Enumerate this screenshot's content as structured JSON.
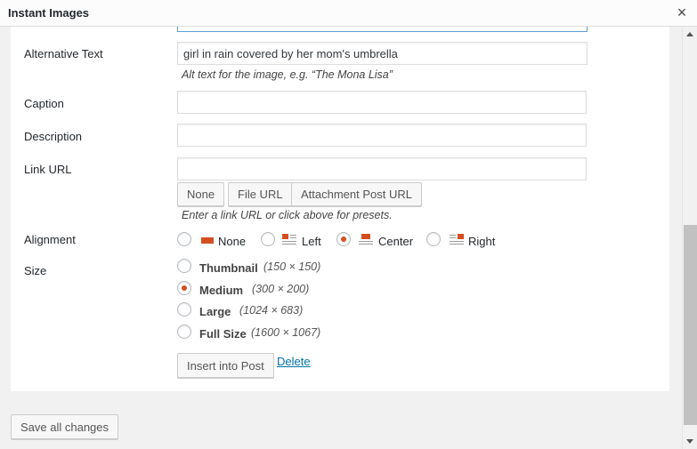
{
  "window": {
    "title": "Instant Images",
    "close_symbol": "×"
  },
  "form": {
    "title_field": {
      "value": ""
    },
    "alt_text": {
      "label": "Alternative Text",
      "value": "girl in rain covered by her mom's umbrella",
      "hint": "Alt text for the image, e.g. “The Mona Lisa”"
    },
    "caption": {
      "label": "Caption",
      "value": ""
    },
    "description": {
      "label": "Description",
      "value": ""
    },
    "link_url": {
      "label": "Link URL",
      "value": "",
      "presets": [
        "None",
        "File URL",
        "Attachment Post URL"
      ],
      "hint": "Enter a link URL or click above for presets."
    },
    "alignment": {
      "label": "Alignment",
      "options": [
        "None",
        "Left",
        "Center",
        "Right"
      ],
      "selected": "Center"
    },
    "size": {
      "label": "Size",
      "options": [
        {
          "name": "Thumbnail",
          "dims": "(150 × 150)"
        },
        {
          "name": "Medium",
          "dims": "(300 × 200)"
        },
        {
          "name": "Large",
          "dims": "(1024 × 683)"
        },
        {
          "name": "Full Size",
          "dims": "(1600 × 1067)"
        }
      ],
      "selected": "Medium"
    },
    "insert_label": "Insert into Post",
    "delete_label": "Delete"
  },
  "footer": {
    "save_label": "Save all changes"
  },
  "colors": {
    "accent": "#d54e21",
    "link": "#0073aa",
    "focus_border": "#5b9dd9"
  }
}
